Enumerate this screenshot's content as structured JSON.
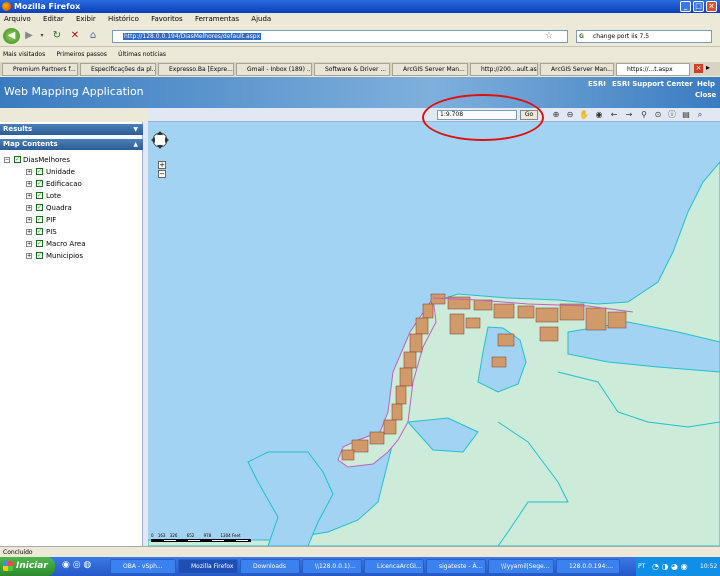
{
  "window": {
    "title": "Mozilla Firefox"
  },
  "menu": [
    "Arquivo",
    "Editar",
    "Exibir",
    "Histórico",
    "Favoritos",
    "Ferramentas",
    "Ajuda"
  ],
  "nav": {
    "url": "http://128.0.0.194/DiasMelhores/default.aspx",
    "search": "change port iis 7.5"
  },
  "bookmarks": [
    "Mais visitados",
    "Primeiros passos",
    "Últimas notícias"
  ],
  "tabs": [
    "Premium Partners f...",
    "Especificações da pl...",
    "Expresso.Ba [Expre...",
    "Gmail - Inbox (189) ...",
    "Software & Driver ...",
    "ArcGIS Server Man...",
    "http://200...ault.aspx",
    "ArcGIS Server Man...",
    "https://...t.aspx"
  ],
  "app": {
    "title": "Web Mapping Application",
    "links": [
      "ESRI",
      "ESRI Support Center",
      "Help",
      "Close"
    ]
  },
  "toolbar": {
    "scale_value": "1:9.708",
    "go_label": "Go"
  },
  "panels": {
    "results": "Results",
    "map_contents": "Map Contents"
  },
  "layers": {
    "root": "DiasMelhores",
    "items": [
      "Unidade",
      "Edificacao",
      "Lote",
      "Quadra",
      "PIF",
      "PIS",
      "Macro Area",
      "Municipios"
    ]
  },
  "scalebar": {
    "ticks": [
      "0",
      "163",
      "326",
      "652",
      "978",
      "1304 Feet"
    ]
  },
  "status": "Concluído",
  "taskbar": {
    "start": "Iniciar",
    "tasks": [
      "OBA - vSph...",
      "Mozilla Firefox",
      "Downloads",
      "\\\\128.0.0.1)...",
      "LicencaArcGI...",
      "sigateste - Á...",
      "\\\\lyyamil|Sege...",
      "128.0.0.194:..."
    ],
    "lang": "PT",
    "clock": "10:52"
  },
  "colors": {
    "map_water": "#a3d3f2",
    "map_land": "#cdebd9",
    "parcels": "#d19a6a",
    "annotation": "#e01010"
  }
}
